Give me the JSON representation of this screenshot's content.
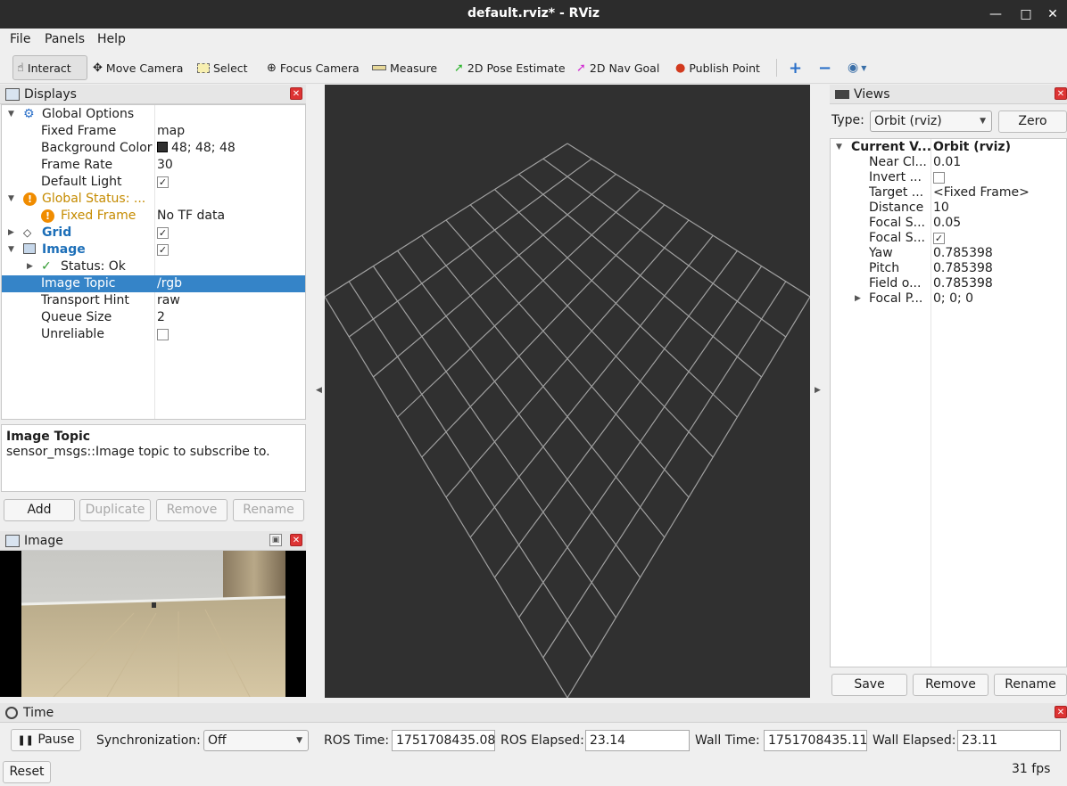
{
  "window": {
    "title": "default.rviz* - RViz"
  },
  "menu": {
    "file": "File",
    "panels": "Panels",
    "help": "Help"
  },
  "toolbar": {
    "interact": "Interact",
    "move_camera": "Move Camera",
    "select": "Select",
    "focus_camera": "Focus Camera",
    "measure": "Measure",
    "pose_estimate": "2D Pose Estimate",
    "nav_goal": "2D Nav Goal",
    "publish_point": "Publish Point"
  },
  "displays": {
    "title": "Displays",
    "rows": {
      "global_options": "Global Options",
      "fixed_frame_k": "Fixed Frame",
      "fixed_frame_v": "map",
      "bg_color_k": "Background Color",
      "bg_color_v": "48; 48; 48",
      "frame_rate_k": "Frame Rate",
      "frame_rate_v": "30",
      "default_light_k": "Default Light",
      "global_status": "Global Status: ...",
      "gs_fixed_frame_k": "Fixed Frame",
      "gs_fixed_frame_v": "No TF data",
      "grid": "Grid",
      "image": "Image",
      "status_ok": "Status: Ok",
      "image_topic_k": "Image Topic",
      "image_topic_v": "/rgb",
      "transport_hint_k": "Transport Hint",
      "transport_hint_v": "raw",
      "queue_size_k": "Queue Size",
      "queue_size_v": "2",
      "unreliable_k": "Unreliable"
    },
    "desc_title": "Image Topic",
    "desc_text": "sensor_msgs::Image topic to subscribe to.",
    "buttons": {
      "add": "Add",
      "duplicate": "Duplicate",
      "remove": "Remove",
      "rename": "Rename"
    }
  },
  "image_panel": {
    "title": "Image"
  },
  "views": {
    "title": "Views",
    "type_label": "Type:",
    "type_value": "Orbit (rviz)",
    "zero": "Zero",
    "rows": {
      "current_k": "Current V...",
      "current_v": "Orbit (rviz)",
      "near_k": "Near Cl...",
      "near_v": "0.01",
      "invert_k": "Invert ...",
      "target_k": "Target ...",
      "target_v": "<Fixed Frame>",
      "distance_k": "Distance",
      "distance_v": "10",
      "focal_s1_k": "Focal S...",
      "focal_s1_v": "0.05",
      "focal_s2_k": "Focal S...",
      "yaw_k": "Yaw",
      "yaw_v": "0.785398",
      "pitch_k": "Pitch",
      "pitch_v": "0.785398",
      "field_k": "Field o...",
      "field_v": "0.785398",
      "focal_p_k": "Focal P...",
      "focal_p_v": "0; 0; 0"
    },
    "buttons": {
      "save": "Save",
      "remove": "Remove",
      "rename": "Rename"
    }
  },
  "time": {
    "title": "Time",
    "pause": "Pause",
    "sync_label": "Synchronization:",
    "sync_value": "Off",
    "ros_time_label": "ROS Time:",
    "ros_time": "1751708435.08",
    "ros_elapsed_label": "ROS Elapsed:",
    "ros_elapsed": "23.14",
    "wall_time_label": "Wall Time:",
    "wall_time": "1751708435.11",
    "wall_elapsed_label": "Wall Elapsed:",
    "wall_elapsed": "23.11",
    "reset": "Reset",
    "fps": "31 fps"
  },
  "colors": {
    "viewport_bg": "#303030",
    "grid_line": "#a0a0a0",
    "selection": "#3584c8",
    "swatch": "#303030"
  }
}
